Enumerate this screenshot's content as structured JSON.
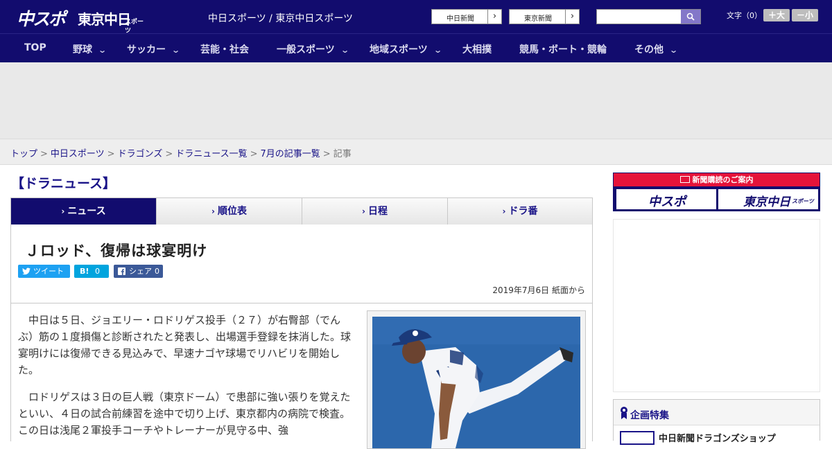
{
  "header": {
    "logo_main": "中スポ",
    "logo_tokyo": "東京中日",
    "logo_sports": "スポーツ",
    "site_name": "中日スポーツ / 東京中日スポーツ",
    "ext_link_1": "中日新聞",
    "ext_link_2": "東京新聞",
    "search_placeholder": "",
    "font_size_label": "文字（0）",
    "font_bigger": "＋大",
    "font_smaller": "－小"
  },
  "nav": {
    "items": [
      {
        "label": "TOP",
        "dropdown": false
      },
      {
        "label": "野球",
        "dropdown": true
      },
      {
        "label": "サッカー",
        "dropdown": true
      },
      {
        "label": "芸能・社会",
        "dropdown": false
      },
      {
        "label": "一般スポーツ",
        "dropdown": true
      },
      {
        "label": "地域スポーツ",
        "dropdown": true
      },
      {
        "label": "大相撲",
        "dropdown": false
      },
      {
        "label": "競馬・ボート・競輪",
        "dropdown": false
      },
      {
        "label": "その他",
        "dropdown": true
      }
    ]
  },
  "breadcrumb": {
    "items": [
      "トップ",
      "中日スポーツ",
      "ドラゴンズ",
      "ドラニュース一覧",
      "7月の記事一覧"
    ],
    "current": "記事"
  },
  "section_title": "【ドラニュース】",
  "tabs": [
    {
      "label": "ニュース",
      "active": true
    },
    {
      "label": "順位表",
      "active": false
    },
    {
      "label": "日程",
      "active": false
    },
    {
      "label": "ドラ番",
      "active": false
    }
  ],
  "article": {
    "headline": "Ｊロッド、復帰は球宴明け",
    "share": {
      "tweet": "ツイート",
      "hatena_icon": "B!",
      "hatena_count": "0",
      "facebook": "シェア",
      "facebook_count": "0"
    },
    "dateline": "2019年7月6日 紙面から",
    "paragraphs": [
      "中日は５日、ジョエリー・ロドリゲス投手（２７）が右臀部（でんぶ）筋の１度損傷と診断されたと発表し、出場選手登録を抹消した。球宴明けには復帰できる見込みで、早速ナゴヤ球場でリハビリを開始した。",
      "ロドリゲスは３日の巨人戦（東京ドーム）で患部に強い張りを覚えたといい、４日の試合前練習を途中で切り上げ、東京都内の病院で検査。この日は浅尾２軍投手コーチやトレーナーが見守る中、強"
    ]
  },
  "sidebar": {
    "subscribe_label": "新聞購読のご案内",
    "logo_1": "中スポ",
    "logo_2": "東京中日",
    "logo_2_small": "スポーツ",
    "feature_title": "企画特集",
    "feature_item": "中日新聞ドラゴンズショップ"
  },
  "colors": {
    "brand_navy": "#120c6e",
    "link": "#1a1488",
    "accent_red": "#e5133a",
    "twitter": "#1da1f2",
    "hatena": "#00a4de",
    "facebook": "#3b5998"
  }
}
